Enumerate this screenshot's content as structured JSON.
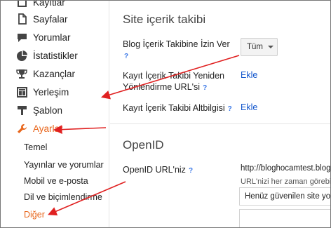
{
  "sidebar": {
    "items": [
      {
        "label": "Kayıtlar",
        "icon": "post-list-icon"
      },
      {
        "label": "Sayfalar",
        "icon": "pages-icon"
      },
      {
        "label": "Yorumlar",
        "icon": "comments-icon"
      },
      {
        "label": "İstatistikler",
        "icon": "stats-icon"
      },
      {
        "label": "Kazançlar",
        "icon": "trophy-icon"
      },
      {
        "label": "Yerleşim",
        "icon": "layout-icon"
      },
      {
        "label": "Şablon",
        "icon": "template-icon"
      },
      {
        "label": "Ayarlar",
        "icon": "wrench-icon",
        "active": true
      }
    ],
    "subitems": [
      {
        "label": "Temel"
      },
      {
        "label": "Yayınlar ve yorumlar"
      },
      {
        "label": "Mobil ve e-posta"
      },
      {
        "label": "Dil ve biçimlendirme"
      },
      {
        "label": "Diğer",
        "active": true
      }
    ]
  },
  "main": {
    "feed_section": {
      "title": "Site içerik takibi",
      "allow_feed_label": "Blog İçerik Takibine İzin Ver",
      "allow_feed_value": "Tüm",
      "redirect_label_line1": "Kayıt İçerik Takibi Yeniden",
      "redirect_label_line2": "Yönlendirme URL'si",
      "redirect_action": "Ekle",
      "footer_label": "Kayıt İçerik Takibi Altbilgisi",
      "footer_action": "Ekle"
    },
    "openid_section": {
      "title": "OpenID",
      "url_label": "OpenID URL'niz",
      "url_value": "http://bloghocamtest.blogspot",
      "url_note": "URL'nizi her zaman görebile",
      "trusted_sites": "Henüz güvenilen site yok"
    },
    "help_glyph": "?"
  },
  "colors": {
    "accent": "#e8661c",
    "link": "#1155cc",
    "help": "#3b78e7",
    "annotation_arrow": "#e02020"
  }
}
